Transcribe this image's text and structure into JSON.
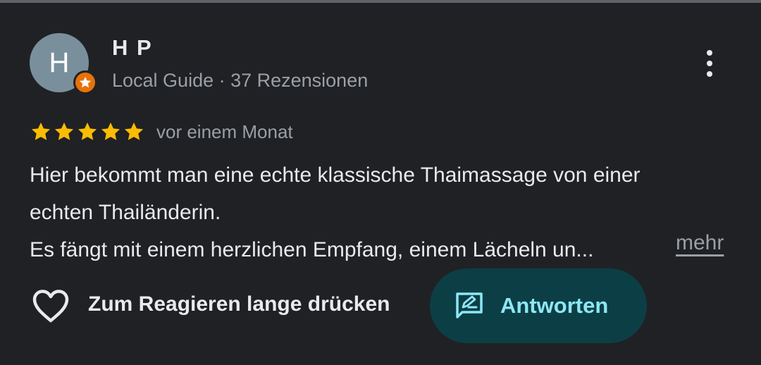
{
  "reviewer": {
    "initial": "H",
    "name": "H P",
    "meta": "Local Guide · 37 Rezensionen"
  },
  "review": {
    "rating": 5,
    "date": "vor einem Monat",
    "lines": [
      "Hier bekommt man eine echte klassische Thaimassage von einer",
      "echten Thailänderin.",
      "Es fängt mit einem herzlichen Empfang, einem Lächeln un..."
    ],
    "more_label": "mehr"
  },
  "actions": {
    "react_label": "Zum Reagieren lange drücken",
    "reply_label": "Antworten"
  },
  "icons": {
    "badge": "local-guide-star-icon",
    "menu": "more-vert-icon",
    "rating": "star-icon",
    "react": "heart-outline-icon",
    "reply": "rate-review-icon"
  },
  "colors": {
    "background": "#202124",
    "star": "#fbbc04",
    "badge": "#e8710a",
    "reply_bg": "#0b3f45",
    "reply_text": "#8ee7f5"
  }
}
